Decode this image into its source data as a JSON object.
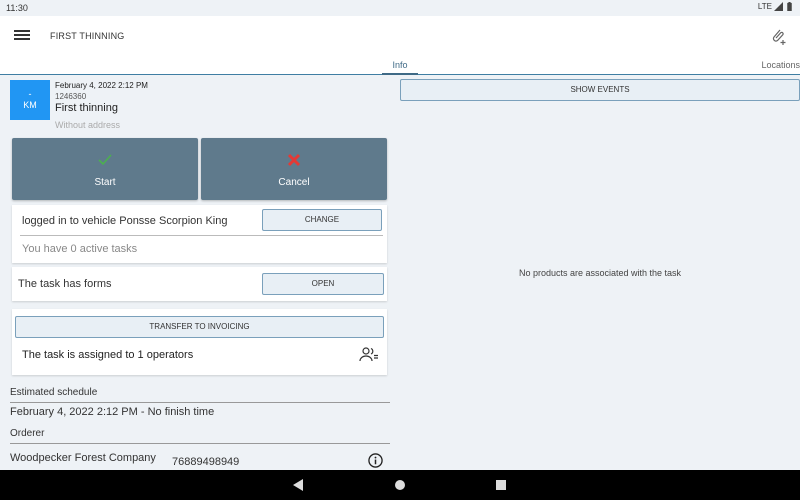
{
  "status": {
    "time": "11:30",
    "network": "LTE"
  },
  "appbar": {
    "title": "FIRST THINNING"
  },
  "tabs": {
    "info": "Info",
    "locations": "Locations"
  },
  "task": {
    "avatar_top": "-",
    "avatar_bottom": "KM",
    "date": "February 4, 2022 2:12 PM",
    "id": "1246360",
    "name": "First thinning",
    "address": "Without address"
  },
  "actions": {
    "start": "Start",
    "cancel": "Cancel"
  },
  "vehicle": {
    "text": "logged in to vehicle Ponsse Scorpion King",
    "change_label": "CHANGE",
    "active_tasks": "You have 0 active tasks"
  },
  "forms": {
    "text": "The task has forms",
    "open_label": "OPEN"
  },
  "operators": {
    "transfer_label": "TRANSFER TO INVOICING",
    "text": "The task is assigned to 1 operators"
  },
  "schedule": {
    "label": "Estimated schedule",
    "value": "February 4, 2022 2:12 PM - No finish time"
  },
  "orderer": {
    "label": "Orderer",
    "name": "Woodpecker Forest Company",
    "phone": "76889498949"
  },
  "right_panel": {
    "events_label": "SHOW EVENTS",
    "empty_text": "No products are associated with the task"
  },
  "colors": {
    "accent": "#3f6a86",
    "action_button": "#5f7a8c",
    "avatar": "#2196f3",
    "start_check": "#4caf50",
    "cancel_x": "#e53935"
  }
}
